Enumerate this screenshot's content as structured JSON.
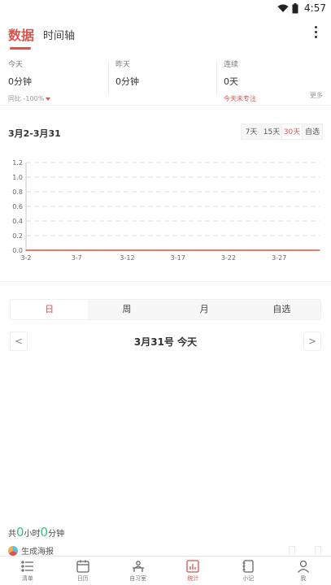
{
  "status_bar": {
    "time": "4:57"
  },
  "header": {
    "tabs": [
      {
        "label": "数据",
        "active": true
      },
      {
        "label": "时间轴",
        "active": false
      }
    ]
  },
  "stats": {
    "today": {
      "label": "今天",
      "value": "0分钟",
      "compare_label": "同比",
      "compare_value": "-100%"
    },
    "yesterday": {
      "label": "昨天",
      "value": "0分钟"
    },
    "streak": {
      "label": "连续",
      "value": "0天",
      "note": "今天未专注"
    },
    "more": "更多"
  },
  "range": {
    "title": "3月2-3月31",
    "options": [
      {
        "label": "7天",
        "active": false
      },
      {
        "label": "15天",
        "active": false
      },
      {
        "label": "30天",
        "active": true
      },
      {
        "label": "自选",
        "active": false
      }
    ]
  },
  "chart_data": {
    "type": "line",
    "x": [
      "3-2",
      "3-3",
      "3-4",
      "3-5",
      "3-6",
      "3-7",
      "3-8",
      "3-9",
      "3-10",
      "3-11",
      "3-12",
      "3-13",
      "3-14",
      "3-15",
      "3-16",
      "3-17",
      "3-18",
      "3-19",
      "3-20",
      "3-21",
      "3-22",
      "3-23",
      "3-24",
      "3-25",
      "3-26",
      "3-27",
      "3-28",
      "3-29",
      "3-30",
      "3-31"
    ],
    "x_tick_labels": [
      "3-2",
      "3-7",
      "3-12",
      "3-17",
      "3-22",
      "3-27"
    ],
    "values": [
      0,
      0,
      0,
      0,
      0,
      0,
      0,
      0,
      0,
      0,
      0,
      0,
      0,
      0,
      0,
      0,
      0,
      0,
      0,
      0,
      0,
      0,
      0,
      0,
      0,
      0,
      0,
      0,
      0,
      0
    ],
    "y_ticks": [
      "1.2",
      "1.0",
      "0.8",
      "0.6",
      "0.4",
      "0.2",
      "0.0"
    ],
    "ylim": [
      0,
      1.2
    ],
    "grid": true,
    "line_color": "#e74c3c"
  },
  "period": {
    "options": [
      {
        "label": "日",
        "active": true
      },
      {
        "label": "周",
        "active": false
      },
      {
        "label": "月",
        "active": false
      },
      {
        "label": "自选",
        "active": false
      }
    ]
  },
  "date_nav": {
    "prev": "<",
    "label": "3月31号 今天",
    "next": ">"
  },
  "total": {
    "prefix": "共",
    "hours": "0",
    "hour_unit": "小时",
    "minutes": "0",
    "minute_unit": "分钟"
  },
  "partial": {
    "label": "生成海报"
  },
  "bottom_nav": [
    {
      "label": "清单",
      "icon": "list-icon",
      "active": false
    },
    {
      "label": "日历",
      "icon": "calendar-icon",
      "active": false
    },
    {
      "label": "自习室",
      "icon": "study-room-icon",
      "active": false
    },
    {
      "label": "统计",
      "icon": "stats-icon",
      "active": true
    },
    {
      "label": "小记",
      "icon": "note-icon",
      "active": false
    },
    {
      "label": "我",
      "icon": "profile-icon",
      "active": false
    }
  ],
  "colors": {
    "accent": "#d9534f",
    "green": "#3cbf7a"
  }
}
